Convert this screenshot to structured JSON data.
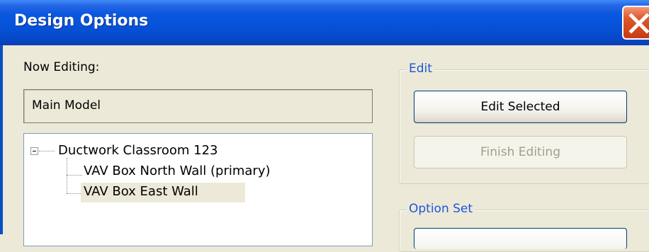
{
  "window": {
    "title": "Design Options"
  },
  "now_editing": {
    "label": "Now Editing:",
    "value": "Main Model"
  },
  "tree": {
    "root": "Ductwork Classroom 123",
    "children": [
      "VAV Box North Wall (primary)",
      "VAV Box East Wall"
    ],
    "selected_index": 1
  },
  "edit_group": {
    "label": "Edit",
    "edit_selected_label": "Edit Selected",
    "finish_editing_label": "Finish Editing"
  },
  "option_set_group": {
    "label": "Option Set"
  },
  "colors": {
    "titlebar_blue": "#0552d8",
    "close_red": "#e0582c",
    "group_label_blue": "#1c55d8",
    "dialog_background": "#ece9d8"
  },
  "icons": {
    "close": "close-x-icon",
    "tree_expander": "collapse-minus-icon"
  }
}
